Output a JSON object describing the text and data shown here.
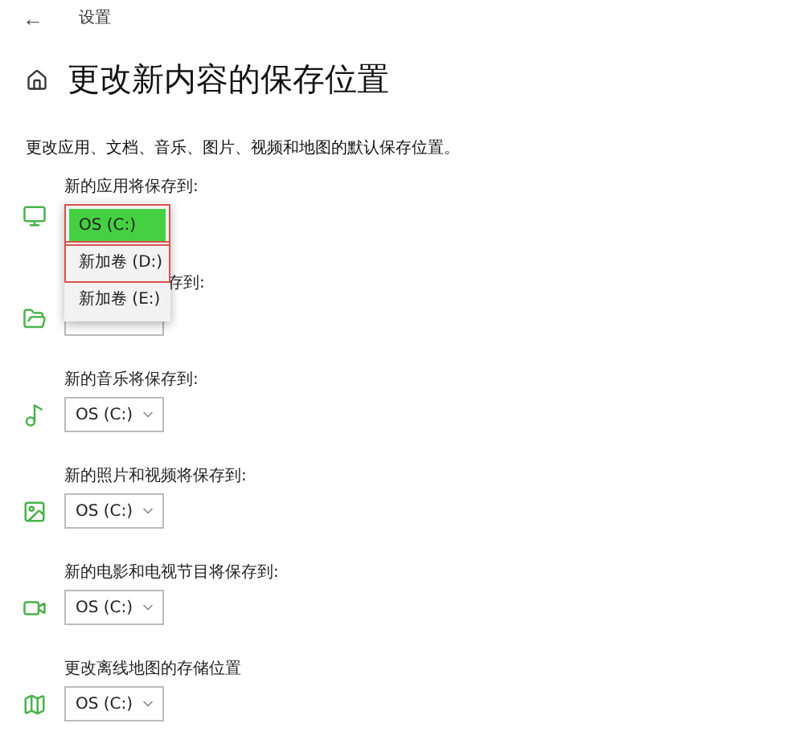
{
  "header": {
    "back": "←",
    "title": "设置"
  },
  "page": {
    "title": "更改新内容的保存位置",
    "description": "更改应用、文档、音乐、图片、视频和地图的默认保存位置。"
  },
  "sections": [
    {
      "kind": "apps",
      "label": "新的应用将保存到:",
      "partly_covered": false,
      "dropdown": {
        "open": true,
        "options": [
          {
            "label": "OS (C:)",
            "selected": true,
            "highlighted": true
          },
          {
            "label": "新加卷 (D:)",
            "selected": false,
            "highlighted": true
          },
          {
            "label": "新加卷 (E:)",
            "selected": false,
            "highlighted": false
          }
        ]
      }
    },
    {
      "kind": "documents",
      "label": "存到:",
      "partly_covered": true
    },
    {
      "kind": "music",
      "label": "新的音乐将保存到:",
      "partly_covered": false,
      "value": "OS (C:)"
    },
    {
      "kind": "photos",
      "label": "新的照片和视频将保存到:",
      "partly_covered": false,
      "value": "OS (C:)"
    },
    {
      "kind": "movies",
      "label": "新的电影和电视节目将保存到:",
      "partly_covered": false,
      "value": "OS (C:)"
    },
    {
      "kind": "maps",
      "label": "更改离线地图的存储位置",
      "partly_covered": false,
      "value": "OS (C:)"
    }
  ]
}
